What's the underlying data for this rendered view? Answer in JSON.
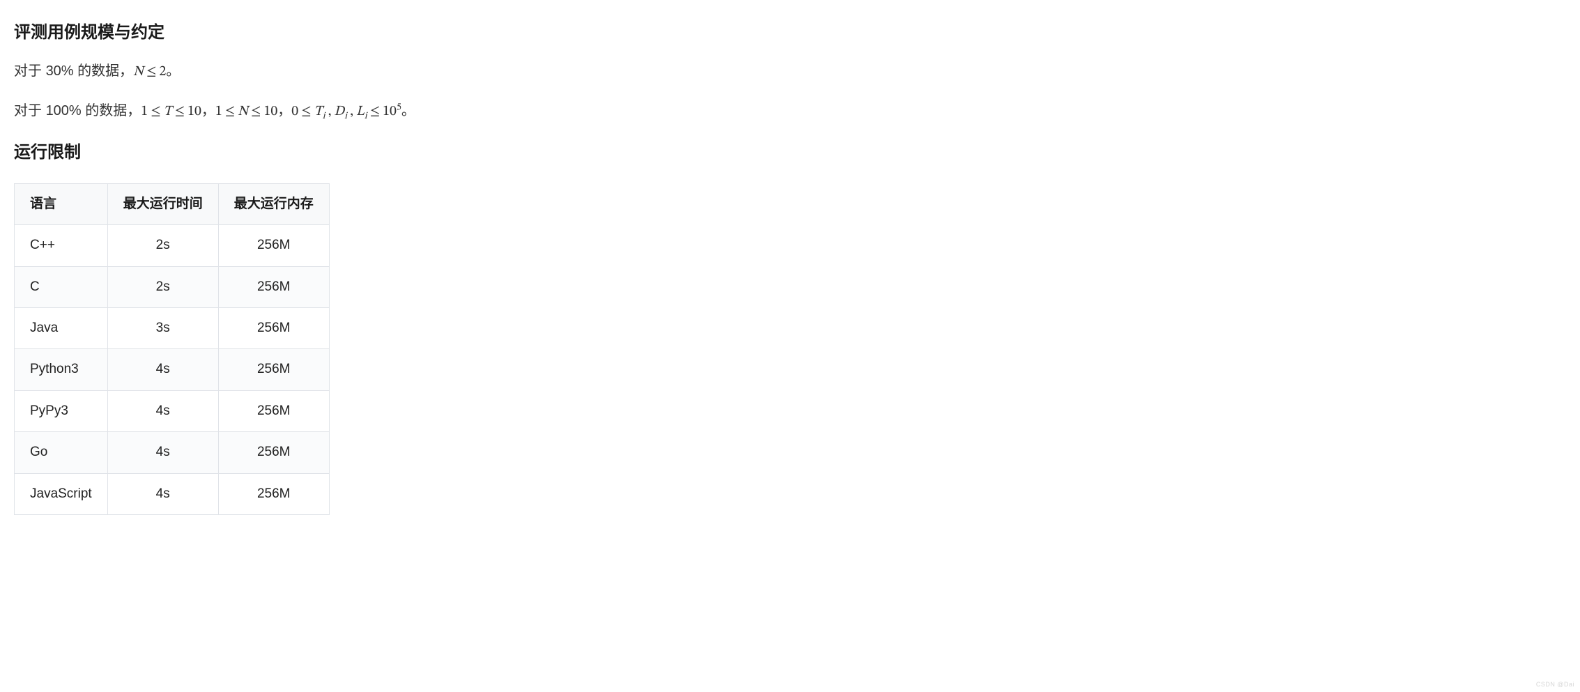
{
  "section1": {
    "heading": "评测用例规模与约定",
    "line1": {
      "prefix": "对于 ",
      "percent": "30%",
      "mid": " 的数据，",
      "math": {
        "lhs": "N",
        "op": "≤",
        "rhs": "2"
      },
      "suffix": "。"
    },
    "line2": {
      "prefix": "对于 ",
      "percent": "100%",
      "mid": " 的数据，",
      "c1": {
        "a": "1",
        "op1": "≤",
        "b": "T",
        "op2": "≤",
        "c": "10"
      },
      "sep1": "，",
      "c2": {
        "a": "1",
        "op1": "≤",
        "b": "N",
        "op2": "≤",
        "c": "10"
      },
      "sep2": "，",
      "c3": {
        "a": "0",
        "op": "≤",
        "vars": "T_i, D_i, L_i",
        "op2": "≤",
        "rhs_base": "10",
        "rhs_exp": "5"
      },
      "suffix": "。"
    }
  },
  "section2": {
    "heading": "运行限制",
    "table": {
      "headers": [
        "语言",
        "最大运行时间",
        "最大运行内存"
      ],
      "rows": [
        {
          "lang": "C++",
          "time": "2s",
          "mem": "256M"
        },
        {
          "lang": "C",
          "time": "2s",
          "mem": "256M"
        },
        {
          "lang": "Java",
          "time": "3s",
          "mem": "256M"
        },
        {
          "lang": "Python3",
          "time": "4s",
          "mem": "256M"
        },
        {
          "lang": "PyPy3",
          "time": "4s",
          "mem": "256M"
        },
        {
          "lang": "Go",
          "time": "4s",
          "mem": "256M"
        },
        {
          "lang": "JavaScript",
          "time": "4s",
          "mem": "256M"
        }
      ]
    }
  },
  "watermark": "CSDN @Dai"
}
